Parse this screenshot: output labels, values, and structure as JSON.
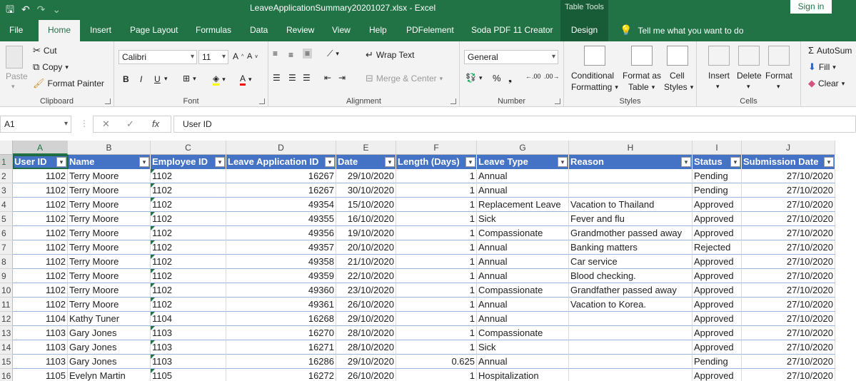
{
  "window": {
    "title": "LeaveApplicationSummary20201027.xlsx  -  Excel",
    "context_tab": "Table Tools",
    "sign_in": "Sign in"
  },
  "tabs": [
    "File",
    "Home",
    "Insert",
    "Page Layout",
    "Formulas",
    "Data",
    "Review",
    "View",
    "Help",
    "PDFelement",
    "Soda PDF 11 Creator",
    "Design"
  ],
  "active_tab": "Home",
  "tell_me": "Tell me what you want to do",
  "ribbon": {
    "clipboard": {
      "label": "Clipboard",
      "paste": "Paste",
      "cut": "Cut",
      "copy": "Copy",
      "format_painter": "Format Painter"
    },
    "font": {
      "label": "Font",
      "name": "Calibri",
      "size": "11",
      "bold": "B",
      "italic": "I",
      "underline": "U"
    },
    "alignment": {
      "label": "Alignment",
      "wrap_text": "Wrap Text",
      "merge_center": "Merge & Center"
    },
    "number": {
      "label": "Number",
      "format": "General"
    },
    "styles": {
      "label": "Styles",
      "conditional": "Conditional",
      "conditional2": "Formatting",
      "format_as": "Format as",
      "format_as2": "Table",
      "cell": "Cell",
      "cell2": "Styles"
    },
    "cells": {
      "label": "Cells",
      "insert": "Insert",
      "delete": "Delete",
      "format": "Format"
    },
    "editing": {
      "autosum": "AutoSum",
      "fill": "Fill",
      "clear": "Clear"
    }
  },
  "formula_bar": {
    "name_box": "A1",
    "value": "User ID"
  },
  "columns": [
    "A",
    "B",
    "C",
    "D",
    "E",
    "F",
    "G",
    "H",
    "I",
    "J"
  ],
  "headers": [
    "User ID",
    "Name",
    "Employee ID",
    "Leave Application ID",
    "Date",
    "Length (Days)",
    "Leave Type",
    "Reason",
    "Status",
    "Submission Date"
  ],
  "rows": [
    [
      "1102",
      "Terry Moore",
      "1102",
      "16267",
      "29/10/2020",
      "1",
      "Annual",
      "",
      "Pending",
      "27/10/2020"
    ],
    [
      "1102",
      "Terry Moore",
      "1102",
      "16267",
      "30/10/2020",
      "1",
      "Annual",
      "",
      "Pending",
      "27/10/2020"
    ],
    [
      "1102",
      "Terry Moore",
      "1102",
      "49354",
      "15/10/2020",
      "1",
      "Replacement Leave",
      "Vacation to Thailand",
      "Approved",
      "27/10/2020"
    ],
    [
      "1102",
      "Terry Moore",
      "1102",
      "49355",
      "16/10/2020",
      "1",
      "Sick",
      "Fever and flu",
      "Approved",
      "27/10/2020"
    ],
    [
      "1102",
      "Terry Moore",
      "1102",
      "49356",
      "19/10/2020",
      "1",
      "Compassionate",
      "Grandmother passed away",
      "Approved",
      "27/10/2020"
    ],
    [
      "1102",
      "Terry Moore",
      "1102",
      "49357",
      "20/10/2020",
      "1",
      "Annual",
      "Banking matters",
      "Rejected",
      "27/10/2020"
    ],
    [
      "1102",
      "Terry Moore",
      "1102",
      "49358",
      "21/10/2020",
      "1",
      "Annual",
      "Car service",
      "Approved",
      "27/10/2020"
    ],
    [
      "1102",
      "Terry Moore",
      "1102",
      "49359",
      "22/10/2020",
      "1",
      "Annual",
      "Blood checking.",
      "Approved",
      "27/10/2020"
    ],
    [
      "1102",
      "Terry Moore",
      "1102",
      "49360",
      "23/10/2020",
      "1",
      "Compassionate",
      "Grandfather passed away",
      "Approved",
      "27/10/2020"
    ],
    [
      "1102",
      "Terry Moore",
      "1102",
      "49361",
      "26/10/2020",
      "1",
      "Annual",
      "Vacation to Korea.",
      "Approved",
      "27/10/2020"
    ],
    [
      "1104",
      "Kathy Tuner",
      "1104",
      "16268",
      "29/10/2020",
      "1",
      "Annual",
      "",
      "Approved",
      "27/10/2020"
    ],
    [
      "1103",
      "Gary Jones",
      "1103",
      "16270",
      "28/10/2020",
      "1",
      "Compassionate",
      "",
      "Approved",
      "27/10/2020"
    ],
    [
      "1103",
      "Gary Jones",
      "1103",
      "16271",
      "28/10/2020",
      "1",
      "Sick",
      "",
      "Approved",
      "27/10/2020"
    ],
    [
      "1103",
      "Gary Jones",
      "1103",
      "16286",
      "29/10/2020",
      "0.625",
      "Annual",
      "",
      "Pending",
      "27/10/2020"
    ],
    [
      "1105",
      "Evelyn Martin",
      "1105",
      "16272",
      "26/10/2020",
      "1",
      "Hospitalization",
      "",
      "Approved",
      "27/10/2020"
    ]
  ],
  "row_numbers": [
    "1",
    "2",
    "3",
    "4",
    "5",
    "6",
    "7",
    "8",
    "9",
    "10",
    "11",
    "12",
    "13",
    "14",
    "15",
    "16"
  ],
  "colors": {
    "excel_green": "#217346",
    "table_header": "#4472c4",
    "sheet_bg": "#ffffff"
  },
  "icons": [
    "save-icon",
    "undo-icon",
    "redo-icon",
    "scissors-icon",
    "copy-icon",
    "paintbrush-icon",
    "lightbulb-icon"
  ]
}
